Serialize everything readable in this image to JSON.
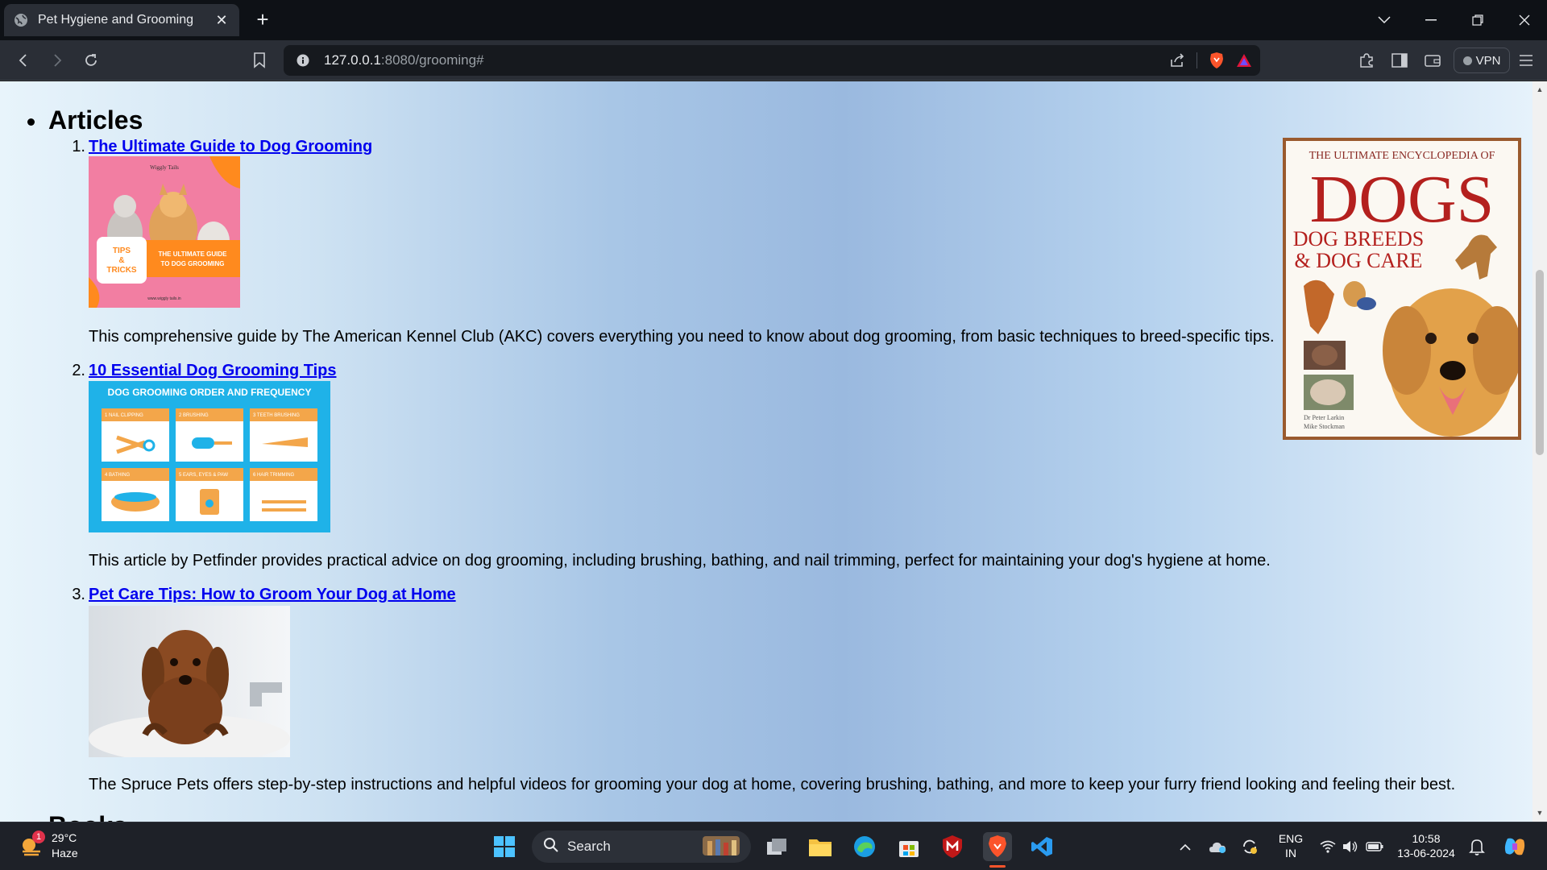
{
  "browser": {
    "tab_title": "Pet Hygiene and Grooming",
    "url_host": "127.0.0.1",
    "url_path": ":8080/grooming#",
    "vpn_label": "VPN"
  },
  "page": {
    "section_title": "Articles",
    "next_section_title": "Books",
    "articles": [
      {
        "number": "1.",
        "title": "The Ultimate Guide to Dog Grooming",
        "description": "This comprehensive guide by The American Kennel Club (AKC) covers everything you need to know about dog grooming, from basic techniques to breed-specific tips.",
        "image_text": {
          "brand": "Wiggly Tails",
          "badge": "TIPS & TRICKS",
          "headline": "THE ULTIMATE GUIDE TO DOG GROOMING",
          "footer": "www.wiggly tails.in"
        }
      },
      {
        "number": "2.",
        "title": "10 Essential Dog Grooming Tips",
        "description": "This article by Petfinder provides practical advice on dog grooming, including brushing, bathing, and nail trimming, perfect for maintaining your dog's hygiene at home.",
        "image_text": {
          "header": "DOG GROOMING ORDER AND FREQUENCY",
          "cells": [
            "1 NAIL CLIPPING",
            "2 BRUSHING",
            "3 TEETH BRUSHING",
            "4 BATHING",
            "5 EARS, EYES & PAW CLEANING",
            "6 HAIR TRIMMING"
          ]
        }
      },
      {
        "number": "3.",
        "title": "Pet Care Tips: How to Groom Your Dog at Home",
        "description": "The Spruce Pets offers step-by-step instructions and helpful videos for grooming your dog at home, covering brushing, bathing, and more to keep your furry friend looking and feeling their best."
      }
    ],
    "book_cover": {
      "top_line": "THE ULTIMATE ENCYCLOPEDIA OF",
      "big_title": "DOGS",
      "sub_line_1": "DOG BREEDS",
      "sub_line_2": "& DOG CARE",
      "author_1": "Dr Peter Larkin",
      "author_2": "Mike Stockman"
    }
  },
  "taskbar": {
    "weather_temp": "29°C",
    "weather_desc": "Haze",
    "weather_badge": "1",
    "search_placeholder": "Search",
    "lang_1": "ENG",
    "lang_2": "IN",
    "time": "10:58",
    "date": "13-06-2024"
  },
  "colors": {
    "link": "#0000ee",
    "brave_orange": "#fb542b",
    "tab_active": "#2a2e36"
  }
}
